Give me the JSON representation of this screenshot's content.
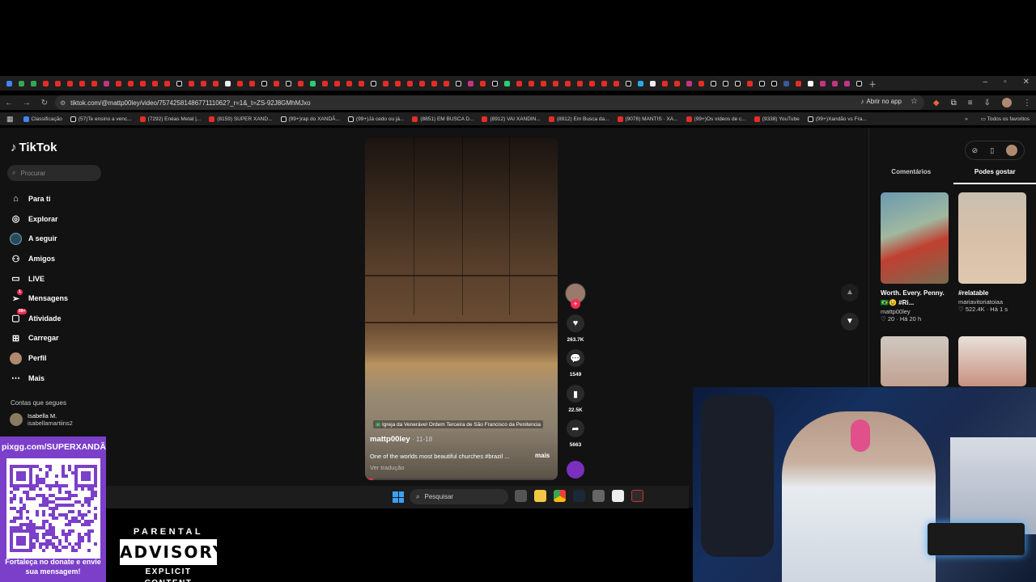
{
  "browser": {
    "url": "tiktok.com/@mattp00ley/video/7574258148677111062?_r=1&_t=ZS-92J8GMhMJxo",
    "open_in_app": "Abrir no app",
    "bookmarks": [
      "Classificação",
      "(57)Te ensino a venc...",
      "(7292) Enéas Metal |...",
      "(8159) SUPER XAND...",
      "(99+)rap do XANDÃ...",
      "(99+)Já cedo ou já...",
      "(8851) EM BUSCA D...",
      "(8912) VAI XANDIN...",
      "(8912) Em Busca da...",
      "(9078) MANTIS · XA...",
      "(99+)Os vídeos de c...",
      "(9338) YouTube",
      "(99+)Xandão vs Fra..."
    ],
    "all_favorites": "Todos os favoritos"
  },
  "tiktok": {
    "logo": "TikTok",
    "search_placeholder": "Procurar",
    "nav": [
      {
        "label": "Para ti",
        "icon": "home-icon",
        "glyph": "⌂"
      },
      {
        "label": "Explorar",
        "icon": "compass-icon",
        "glyph": "◎"
      },
      {
        "label": "A seguir",
        "icon": "following-avatar-icon",
        "glyph": "●"
      },
      {
        "label": "Amigos",
        "icon": "friends-icon",
        "glyph": "⚇"
      },
      {
        "label": "LIVE",
        "icon": "live-icon",
        "glyph": "▭"
      },
      {
        "label": "Mensagens",
        "icon": "messages-icon",
        "glyph": "➢",
        "badge": "1"
      },
      {
        "label": "Atividade",
        "icon": "activity-icon",
        "glyph": "▢",
        "badge": "99+"
      },
      {
        "label": "Carregar",
        "icon": "upload-icon",
        "glyph": "⊞"
      },
      {
        "label": "Perfil",
        "icon": "profile-avatar-icon",
        "glyph": "●"
      },
      {
        "label": "Mais",
        "icon": "more-icon",
        "glyph": "⋯"
      }
    ],
    "follows_title": "Contas que segues",
    "follow": {
      "name": "Isabella M.",
      "handle": "isabellamartiins2"
    },
    "video": {
      "location": "Igreja da Venerável Ordem Terceira de São Francisco da Penitencia",
      "author": "mattp00ley",
      "date": "· 11-18",
      "description": "One of the worlds most beautiful churches #brazil ...",
      "more": "mais",
      "translate": "Ver tradução",
      "progress": 0.04
    },
    "actions": {
      "likes": "263.7K",
      "comments": "1549",
      "saves": "22.5K",
      "shares": "5663"
    },
    "right_panel": {
      "tabs": [
        "Comentários",
        "Podes gostar"
      ],
      "active_tab": 1,
      "cards": [
        {
          "title": "Worth. Every. Penny. 🇧🇷😉 #Ri...",
          "author": "mattp00ley",
          "likes": "20",
          "age": "Há 20 h"
        },
        {
          "title": "#relatable",
          "author": "mariavitoriatoiaa",
          "likes": "522.4K",
          "age": "Há 1 s"
        }
      ]
    }
  },
  "taskbar": {
    "search_placeholder": "Pesquisar"
  },
  "overlays": {
    "qr_url": "pixgg.com/SUPERXANDÃ",
    "qr_message": "Fortaleça no donate e envie sua mensagem!",
    "advisory_top": "PARENTAL",
    "advisory_mid": "ADVISORY",
    "advisory_bottom": "EXPLICIT CONTENT"
  },
  "colors": {
    "tiktok_red": "#fe2c55",
    "qr_purple": "#7b3fc9",
    "page_bg": "#121212"
  }
}
